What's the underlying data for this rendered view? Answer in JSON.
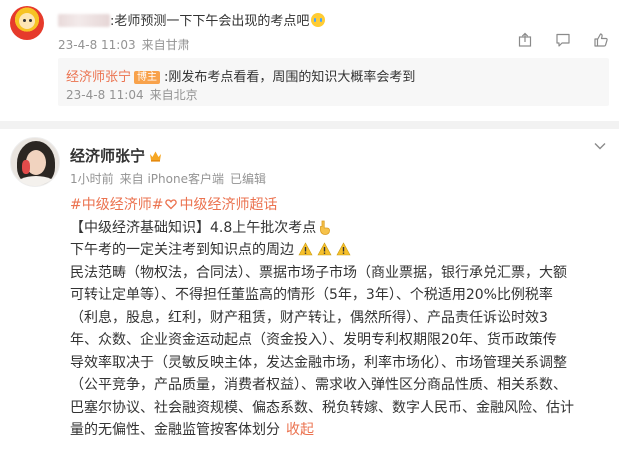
{
  "comment": {
    "name_suffix": ":",
    "text": "老师预测一下下午会出现的考点吧",
    "emoji": "cry-emoji",
    "date": "23-4-8 11:03",
    "location": "来自甘肃",
    "icons": [
      "share-icon",
      "comment-icon",
      "like-icon"
    ],
    "reply": {
      "author": "经济师张宁",
      "badge": "博主",
      "text": ":刚发布考点看看，周围的知识大概率会考到",
      "date": "23-4-8 11:04",
      "location": "来自北京"
    }
  },
  "post": {
    "author": "经济师张宁",
    "time": "1小时前",
    "source": "来自 iPhone客户端",
    "edited": "已编辑",
    "topic1": "#中级经济师#",
    "topic2": "中级经济师超话",
    "title": "【中级经济基础知识】4.8上午批次考点",
    "subtitle": "下午考的一定关注考到知识点的周边",
    "lines": [
      "民法范畴（物权法，合同法）、票据市场子市场（商业票据，银行承兑汇票，大额",
      "可转让定单等）、不得担任董监高的情形（5年，3年）、个税适用20%比例税率",
      "（利息，股息，红利，财产租赁，财产转让，偶然所得）、产品责任诉讼时效3",
      "年、众数、企业资金运动起点（资金投入）、发明专利权期限20年、货币政策传",
      "导效率取决于（灵敏反映主体，发达金融市场，利率市场化）、市场管理关系调整",
      "（公平竞争，产品质量，消费者权益）、需求收入弹性区分商品性质、相关系数、",
      "巴塞尔协议、社会融资规模、偏态系数、税负转嫁、数字人民币、金融风险、估计",
      "量的无偏性、金融监管按客体划分"
    ],
    "collapse": "收起",
    "accent_color": "#eb7350"
  }
}
